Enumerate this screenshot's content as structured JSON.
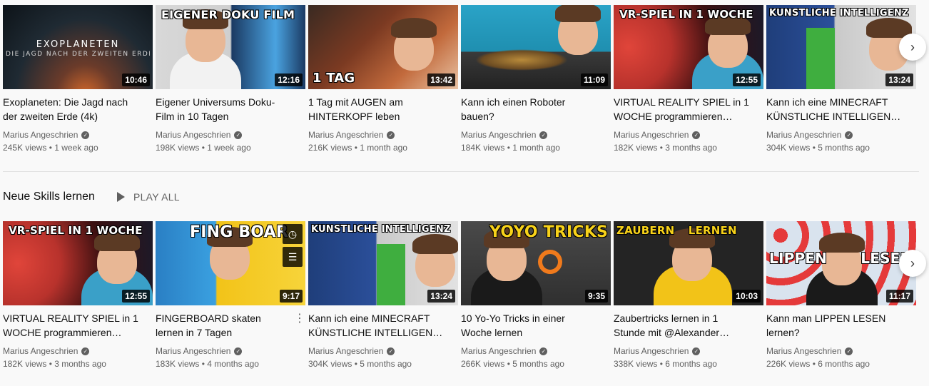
{
  "channel_name": "Marius Angeschrien",
  "verified_icon": "verified-check-icon",
  "shelves": [
    {
      "title": "",
      "videos": [
        {
          "title": "Exoplaneten: Die Jagd nach der zweiten Erde (4k)",
          "duration": "10:46",
          "views": "245K views",
          "age": "1 week ago",
          "thumb_text": "EXOPLANETEN",
          "thumb_subtext": "DIE JAGD NACH DER ZWEITEN ERDE",
          "bg": "#1f2a33"
        },
        {
          "title": "Eigener Universums Doku-Film in 10 Tagen",
          "duration": "12:16",
          "views": "198K views",
          "age": "1 week ago",
          "thumb_text": "EIGENER DOKU FILM",
          "bg": "#c9c9c9"
        },
        {
          "title": "1 Tag mit AUGEN am HINTERKOPF leben",
          "duration": "13:42",
          "views": "216K views",
          "age": "1 month ago",
          "thumb_text": "1 TAG",
          "bg": "#7b3a22"
        },
        {
          "title": "Kann ich einen Roboter bauen?",
          "duration": "11:09",
          "views": "184K views",
          "age": "1 month ago",
          "thumb_text": "",
          "bg": "#1f8fb0"
        },
        {
          "title": "VIRTUAL REALITY SPIEL in 1 WOCHE programmieren…",
          "duration": "12:55",
          "views": "182K views",
          "age": "3 months ago",
          "thumb_text": "VR-SPIEL IN 1 WOCHE",
          "bg": "#b8322c"
        },
        {
          "title": "Kann ich eine MINECRAFT KÜNSTLICHE INTELLIGEN…",
          "duration": "13:24",
          "views": "304K views",
          "age": "5 months ago",
          "thumb_text": "KÜNSTLICHE INTELLIGENZ",
          "bg": "#2b4f9a"
        }
      ]
    },
    {
      "title": "Neue Skills lernen",
      "play_all": "PLAY ALL",
      "videos": [
        {
          "title": "VIRTUAL REALITY SPIEL in 1 WOCHE programmieren…",
          "duration": "12:55",
          "views": "182K views",
          "age": "3 months ago",
          "thumb_text": "VR-SPIEL IN 1 WOCHE",
          "bg": "#b8322c"
        },
        {
          "title": "FINGERBOARD skaten lernen in 7 Tagen",
          "duration": "9:17",
          "views": "183K views",
          "age": "4 months ago",
          "thumb_text": "FING BOAR",
          "bg": "#2a7fc4"
        },
        {
          "title": "Kann ich eine MINECRAFT KÜNSTLICHE INTELLIGEN…",
          "duration": "13:24",
          "views": "304K views",
          "age": "5 months ago",
          "thumb_text": "KÜNSTLICHE INTELLIGENZ",
          "bg": "#2b4f9a"
        },
        {
          "title": "10 Yo-Yo Tricks in einer Woche lernen",
          "duration": "9:35",
          "views": "266K views",
          "age": "5 months ago",
          "thumb_text": "YOYO TRICKS",
          "bg": "#3a3a3a"
        },
        {
          "title": "Zaubertricks lernen in 1 Stunde mit @Alexander…",
          "duration": "10:03",
          "views": "338K views",
          "age": "6 months ago",
          "thumb_text": "ZAUBERN LERNEN",
          "bg": "#2b2b2b"
        },
        {
          "title": "Kann man LIPPEN LESEN lernen?",
          "duration": "11:17",
          "views": "226K views",
          "age": "6 months ago",
          "thumb_text": "LIPPEN LESEN",
          "bg": "#d9e3ee"
        }
      ]
    }
  ],
  "icons": {
    "next": "chevron-right-icon",
    "play": "play-icon",
    "watch_later": "clock-icon",
    "add_to_queue": "queue-icon",
    "more": "more-vert-icon"
  },
  "colors": {
    "background": "#f9f9f9",
    "text": "#0f0f0f",
    "secondary_text": "#606060",
    "duration_badge": "#000000"
  }
}
